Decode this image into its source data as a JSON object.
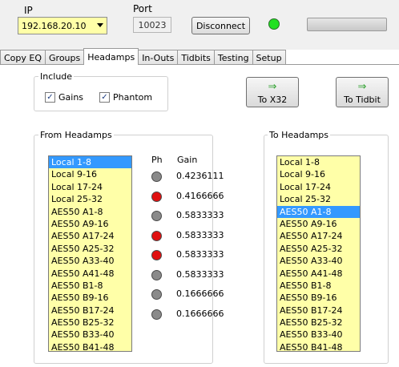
{
  "header": {
    "ip_label": "IP",
    "ip_value": "192.168.20.10",
    "port_label": "Port",
    "port_value": "10023",
    "disconnect_label": "Disconnect",
    "status_color": "#22e022"
  },
  "tabs": [
    {
      "label": "Copy EQ",
      "active": false
    },
    {
      "label": "Groups",
      "active": false
    },
    {
      "label": "Headamps",
      "active": true
    },
    {
      "label": "In-Outs",
      "active": false
    },
    {
      "label": "Tidbits",
      "active": false
    },
    {
      "label": "Testing",
      "active": false
    },
    {
      "label": "Setup",
      "active": false
    }
  ],
  "include": {
    "title": "Include",
    "gains_label": "Gains",
    "gains_checked": true,
    "phantom_label": "Phantom",
    "phantom_checked": true
  },
  "buttons": {
    "to_x32": "To X32",
    "to_tidbit": "To Tidbit",
    "arrow_icon": "⇒"
  },
  "from_headamps": {
    "title": "From Headamps",
    "ph_header": "Ph",
    "gain_header": "Gain",
    "items": [
      "Local 1-8",
      "Local 9-16",
      "Local 17-24",
      "Local 25-32",
      "AES50 A1-8",
      "AES50 A9-16",
      "AES50 A17-24",
      "AES50 A25-32",
      "AES50 A33-40",
      "AES50 A41-48",
      "AES50 B1-8",
      "AES50 B9-16",
      "AES50 B17-24",
      "AES50 B25-32",
      "AES50 B33-40",
      "AES50 B41-48"
    ],
    "selected": 0,
    "rows": [
      {
        "phantom": false,
        "gain": "0.4236111"
      },
      {
        "phantom": true,
        "gain": "0.4166666"
      },
      {
        "phantom": false,
        "gain": "0.5833333"
      },
      {
        "phantom": true,
        "gain": "0.5833333"
      },
      {
        "phantom": true,
        "gain": "0.5833333"
      },
      {
        "phantom": false,
        "gain": "0.5833333"
      },
      {
        "phantom": false,
        "gain": "0.1666666"
      },
      {
        "phantom": false,
        "gain": "0.1666666"
      }
    ]
  },
  "to_headamps": {
    "title": "To Headamps",
    "items": [
      "Local 1-8",
      "Local 9-16",
      "Local 17-24",
      "Local 25-32",
      "AES50 A1-8",
      "AES50 A9-16",
      "AES50 A17-24",
      "AES50 A25-32",
      "AES50 A33-40",
      "AES50 A41-48",
      "AES50 B1-8",
      "AES50 B9-16",
      "AES50 B17-24",
      "AES50 B25-32",
      "AES50 B33-40",
      "AES50 B41-48"
    ],
    "selected": 4
  }
}
